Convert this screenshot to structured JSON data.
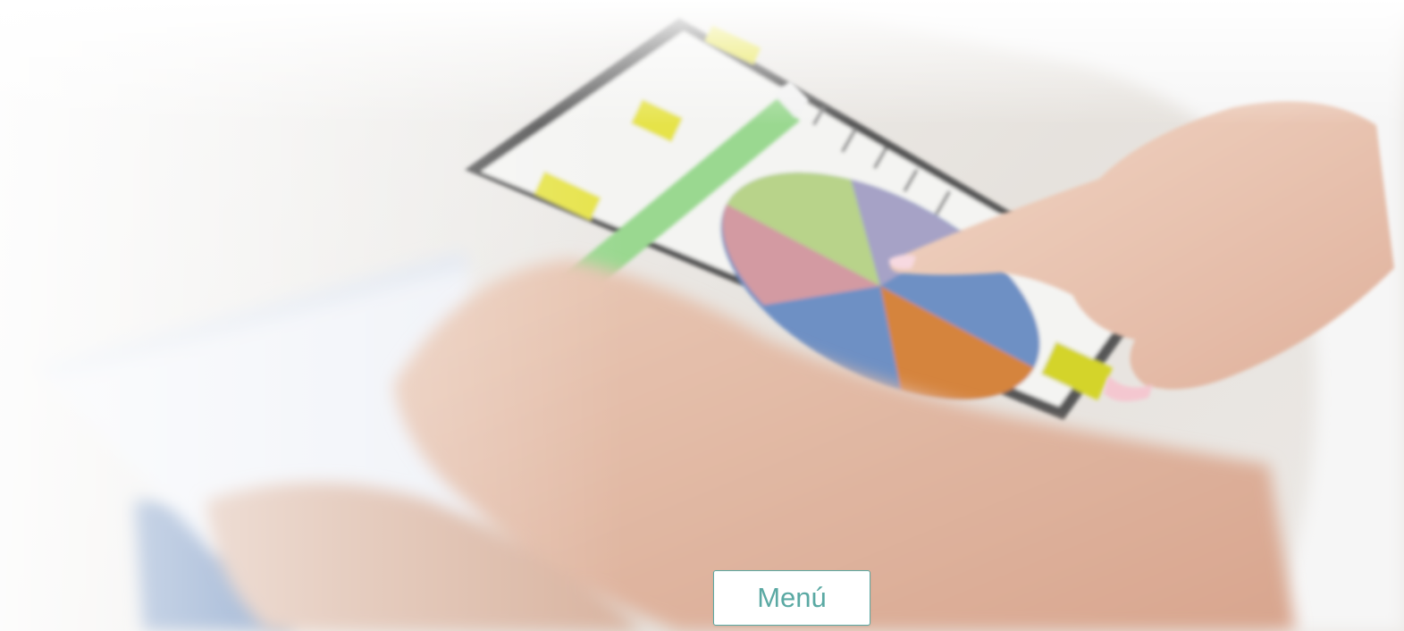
{
  "hero": {
    "image_alt": "",
    "menu_button_label": "Menú"
  },
  "colors": {
    "accent": "#5aa9a3",
    "button_background": "#ffffff"
  },
  "icons": {
    "chart_illustration": "pie-chart-clipboard"
  }
}
